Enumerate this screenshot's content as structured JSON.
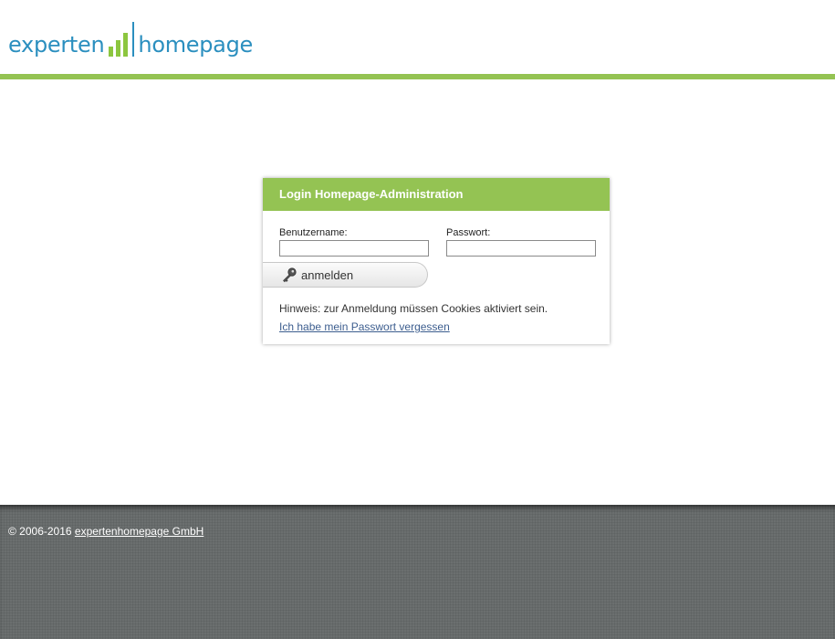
{
  "brand": {
    "part1": "experten",
    "part2": "homepage",
    "colors": {
      "blue": "#2b8fbf",
      "green": "#94c353"
    }
  },
  "login": {
    "title": "Login Homepage-Administration",
    "username_label": "Benutzername:",
    "username_value": "",
    "password_label": "Passwort:",
    "password_value": "",
    "submit_label": "anmelden",
    "submit_icon": "key-icon",
    "hint": "Hinweis: zur Anmeldung müssen Cookies aktiviert sein.",
    "forgot_link": "Ich habe mein Passwort vergessen"
  },
  "footer": {
    "copyright": "© 2006-2016",
    "company_link": "expertenhomepage GmbH"
  }
}
